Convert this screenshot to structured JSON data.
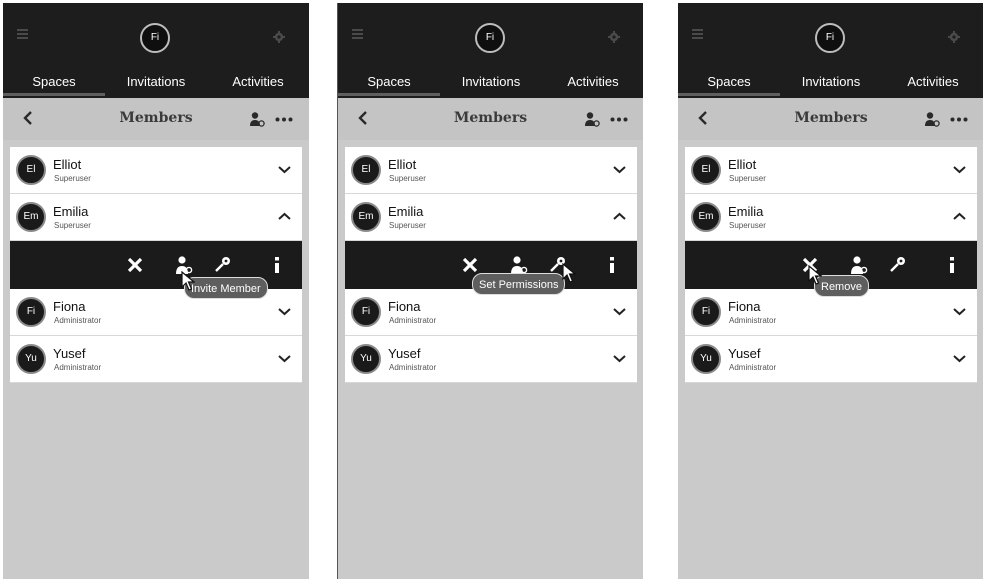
{
  "app": {
    "avatar_initials": "Fi",
    "tabs": [
      "Spaces",
      "Invitations",
      "Activities"
    ],
    "header_title": "Members"
  },
  "members": [
    {
      "initials": "El",
      "name": "Elliot",
      "role": "Superuser"
    },
    {
      "initials": "Em",
      "name": "Emilia",
      "role": "Superuser"
    },
    {
      "initials": "Fi",
      "name": "Fiona",
      "role": "Administrator"
    },
    {
      "initials": "Yu",
      "name": "Yusef",
      "role": "Administrator"
    }
  ],
  "tooltips": {
    "invite": "Invite Member",
    "permissions": "Set Permissions",
    "remove": "Remove"
  },
  "colors": {
    "dark": "#1d1d1d",
    "background": "#cacaca"
  },
  "icons": [
    "menu-icon",
    "gear-icon",
    "back-icon",
    "add-user-icon",
    "more-icon",
    "chevron-down-icon",
    "chevron-up-icon",
    "close-icon",
    "user-icon",
    "key-icon",
    "info-icon",
    "cursor-icon"
  ]
}
